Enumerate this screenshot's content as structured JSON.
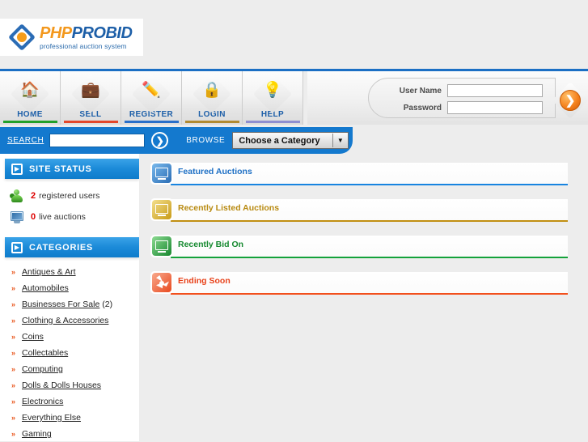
{
  "logo": {
    "part1": "PHP",
    "part2": "PROBID",
    "tagline": "professional auction system"
  },
  "nav": {
    "items": [
      {
        "label": "HOME",
        "icon": "house-icon",
        "glyph": "🏠",
        "underline": "#22a02a"
      },
      {
        "label": "SELL",
        "icon": "briefcase-icon",
        "glyph": "💼",
        "underline": "#e2472b"
      },
      {
        "label": "REGISTER",
        "icon": "pencil-icon",
        "glyph": "✏️",
        "underline": "#2a6fc9"
      },
      {
        "label": "LOGIN",
        "icon": "padlock-icon",
        "glyph": "🔒",
        "underline": "#b08a32"
      },
      {
        "label": "HELP",
        "icon": "lightbulb-icon",
        "glyph": "💡",
        "underline": "#8f8fd0"
      }
    ]
  },
  "login": {
    "username_label": "User Name",
    "username_value": "",
    "username_placeholder": "",
    "password_label": "Password",
    "password_value": "",
    "password_placeholder": "",
    "submit_glyph": "❯"
  },
  "search": {
    "label": "SEARCH",
    "value": "",
    "placeholder": "",
    "go_glyph": "❯",
    "browse_label": "BROWSE",
    "category_selected": "Choose a Category",
    "dropdown_glyph": "▼"
  },
  "sidebar": {
    "status_panel": {
      "title": "SITE STATUS",
      "icon": "play-square-icon",
      "icon_glyph": "▶",
      "items": [
        {
          "count": "2",
          "text": "registered users",
          "icon": "user-icon"
        },
        {
          "count": "0",
          "text": "live auctions",
          "icon": "monitor-icon"
        }
      ]
    },
    "categories_panel": {
      "title": "CATEGORIES",
      "icon": "play-square-icon",
      "icon_glyph": "▶",
      "bullet_glyph": "»",
      "items": [
        {
          "label": "Antiques & Art",
          "count": ""
        },
        {
          "label": "Automobiles",
          "count": ""
        },
        {
          "label": "Businesses For Sale",
          "count": "(2)"
        },
        {
          "label": "Clothing & Accessories",
          "count": ""
        },
        {
          "label": "Coins",
          "count": ""
        },
        {
          "label": "Collectables",
          "count": ""
        },
        {
          "label": "Computing",
          "count": ""
        },
        {
          "label": "Dolls & Dolls Houses",
          "count": ""
        },
        {
          "label": "Electronics",
          "count": ""
        },
        {
          "label": "Everything Else",
          "count": ""
        },
        {
          "label": "Gaming",
          "count": ""
        }
      ]
    }
  },
  "main": {
    "sections": [
      {
        "title": "Featured Auctions",
        "color": "#1d6fc4",
        "rule": "#1884e0",
        "icon": "monitor-featured-icon",
        "icon_from": "#79b9ec",
        "icon_to": "#2a6cb4"
      },
      {
        "title": "Recently Listed Auctions",
        "color": "#b88a10",
        "rule": "#c18f12",
        "icon": "monitor-listed-icon",
        "icon_from": "#f3df8d",
        "icon_to": "#c89a16"
      },
      {
        "title": "Recently Bid On",
        "color": "#15892f",
        "rule": "#14a23a",
        "icon": "monitor-bid-icon",
        "icon_from": "#8ddb92",
        "icon_to": "#16862e"
      },
      {
        "title": "Ending Soon",
        "color": "#e8421a",
        "rule": "#f2501d",
        "icon": "radiation-ending-icon",
        "icon_from": "#f9a98c",
        "icon_to": "#e8491f"
      }
    ]
  },
  "colors": {
    "page_bg": "#ededed",
    "brand_blue": "#1479ce",
    "panel_white": "#ffffff",
    "accent_orange": "#f5831f",
    "alert_red": "#dd0000"
  }
}
